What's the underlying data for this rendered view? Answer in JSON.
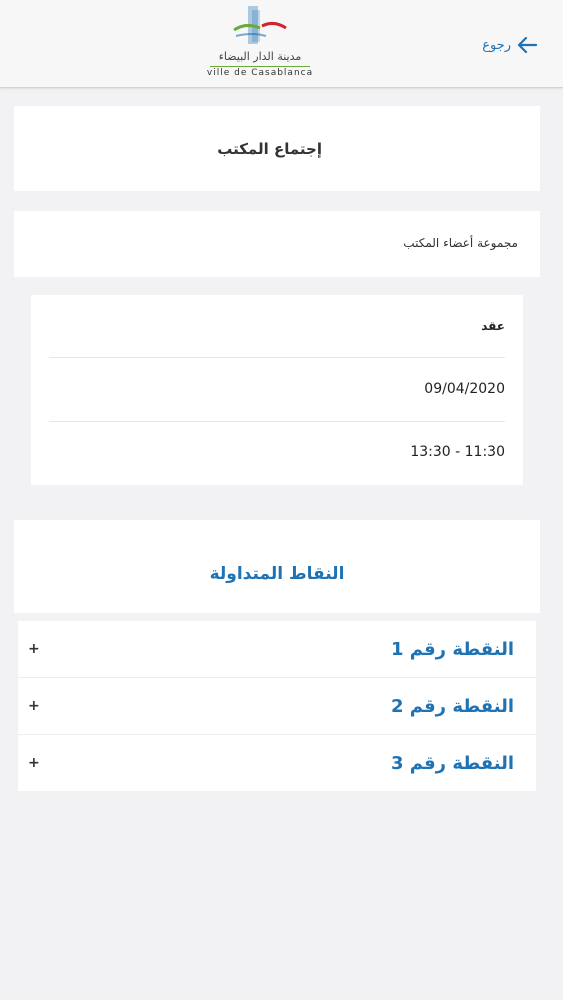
{
  "header": {
    "logo_ar": "مدينة الدار البيضاء",
    "logo_fr": "ville de Casablanca",
    "back_label": "رجوع",
    "brand_blue": "#1f73b5",
    "brand_green": "#6aaa3a",
    "brand_red": "#d0262b"
  },
  "meeting": {
    "title": "إجتماع المكتب",
    "group": "مجموعة أعضاء المكتب"
  },
  "details": {
    "status": "عقد",
    "date": "09/04/2020",
    "time": "13:30 - 11:30"
  },
  "points": {
    "heading": "النقاط المتداولة",
    "expand_symbol": "+",
    "items": [
      {
        "label": "النقطة رقم 1"
      },
      {
        "label": "النقطة رقم 2"
      },
      {
        "label": "النقطة رقم 3"
      }
    ]
  }
}
